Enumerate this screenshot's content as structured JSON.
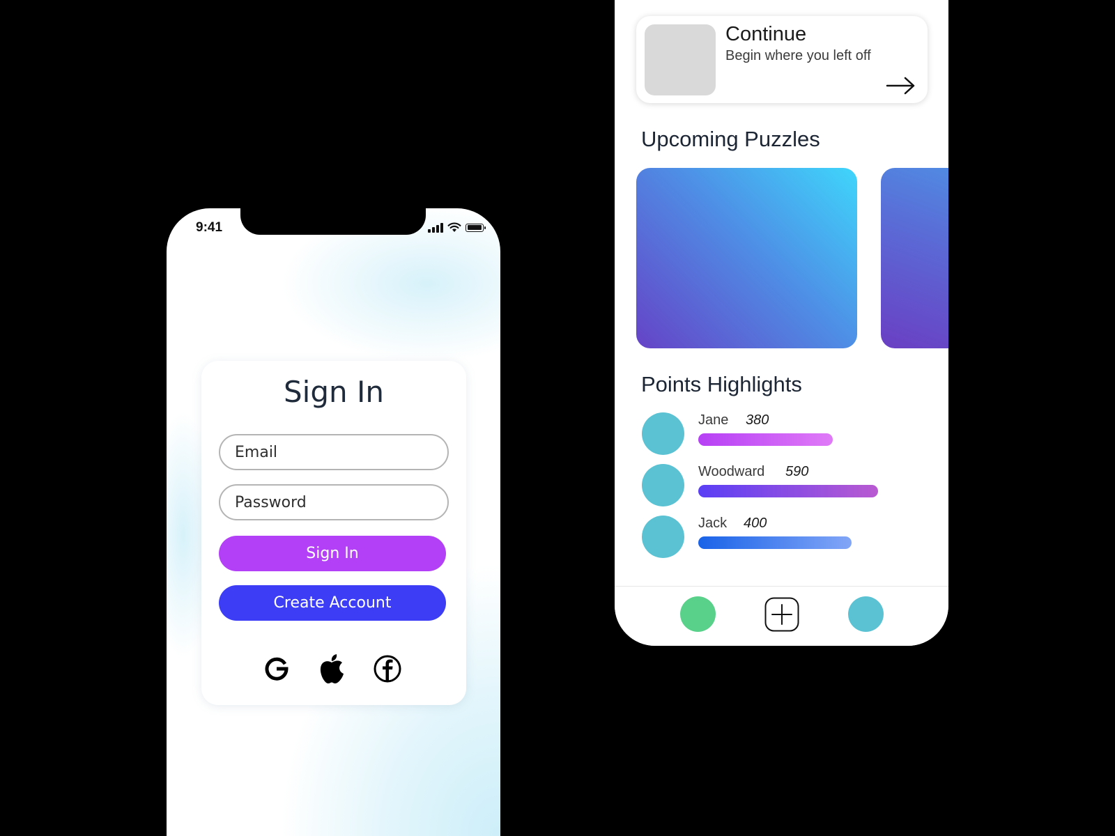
{
  "status_bar": {
    "time": "9:41"
  },
  "signin": {
    "title": "Sign In",
    "email_placeholder": "Email",
    "password_placeholder": "Password",
    "signin_button": "Sign In",
    "create_account_button": "Create Account",
    "social": [
      "google-icon",
      "apple-icon",
      "facebook-icon"
    ]
  },
  "home": {
    "continue": {
      "title": "Continue",
      "subtitle": "Begin where you left off"
    },
    "upcoming_title": "Upcoming Puzzles",
    "points_title": "Points Highlights",
    "players": [
      {
        "name": "Jane",
        "score": "380",
        "bar_colors": [
          "#b640f5",
          "#e07af7"
        ]
      },
      {
        "name": "Woodward",
        "score": "590",
        "bar_colors": [
          "#5a3ff5",
          "#b95ad1"
        ]
      },
      {
        "name": "Jack",
        "score": "400",
        "bar_colors": [
          "#1a63e8",
          "#82a6f7"
        ]
      }
    ],
    "nav": [
      "home-dot",
      "add-icon",
      "profile-dot"
    ]
  },
  "colors": {
    "signin_button": "#b340f7",
    "create_button": "#3c3df5",
    "avatar": "#5bc2d3",
    "nav_green": "#5ad18a",
    "nav_teal": "#5bc2d3"
  }
}
